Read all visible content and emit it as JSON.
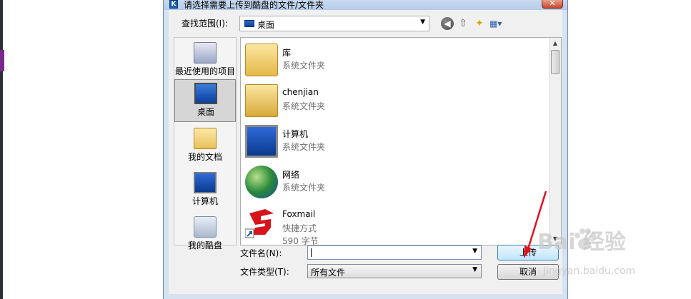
{
  "window": {
    "title": "请选择需要上传到酷盘的文件/文件夹",
    "close_glyph": "✕"
  },
  "toolbar": {
    "lookin_label": "查找范围(I):",
    "lookin_value": "桌面",
    "back_glyph": "◀",
    "up_glyph": "⇧",
    "newfolder_glyph": "✦",
    "view_glyph": "▦▾"
  },
  "places": [
    {
      "label": "最近使用的项目",
      "icon": "recent-items-icon"
    },
    {
      "label": "桌面",
      "icon": "desktop-icon",
      "selected": true
    },
    {
      "label": "我的文档",
      "icon": "documents-icon"
    },
    {
      "label": "计算机",
      "icon": "computer-icon"
    },
    {
      "label": "我的酷盘",
      "icon": "kupan-disk-icon"
    }
  ],
  "files": [
    {
      "name": "库",
      "type": "系统文件夹",
      "icon": "library-folder-icon"
    },
    {
      "name": "chenjian",
      "type": "系统文件夹",
      "icon": "user-folder-icon"
    },
    {
      "name": "计算机",
      "type": "系统文件夹",
      "icon": "computer-icon"
    },
    {
      "name": "网络",
      "type": "系统文件夹",
      "icon": "network-globe-icon"
    },
    {
      "name": "Foxmail",
      "type": "快捷方式",
      "size": "590 字节",
      "icon": "foxmail-icon"
    }
  ],
  "form": {
    "filename_label": "文件名(N):",
    "filename_value": "",
    "filetype_label": "文件类型(T):",
    "filetype_value": "所有文件"
  },
  "buttons": {
    "upload": "上传",
    "cancel": "取消"
  },
  "watermark": {
    "logo": "Bai  经验",
    "url": "jingyan.baidu.com"
  },
  "colors": {
    "dialog_frame": "#d5e2f2",
    "annotation_arrow": "#e0141e"
  }
}
